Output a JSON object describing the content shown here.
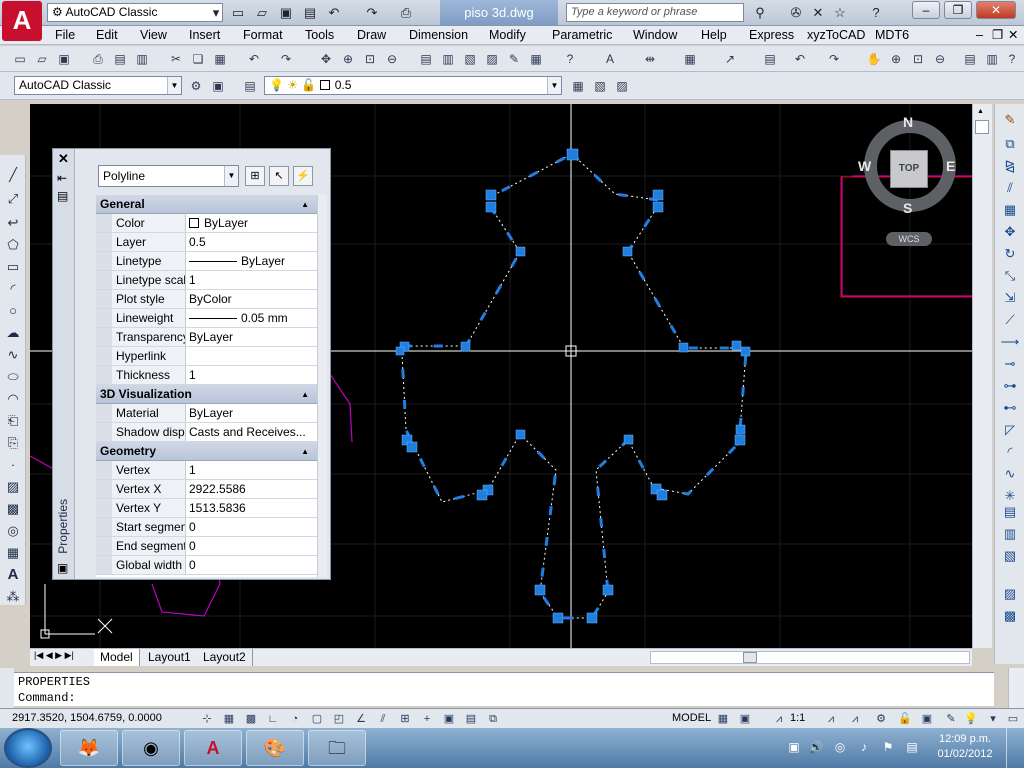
{
  "app": {
    "logo_letter": "A",
    "workspace": "AutoCAD Classic",
    "document_title": "piso 3d.dwg",
    "search_placeholder": "Type a keyword or phrase"
  },
  "menu": [
    "File",
    "Edit",
    "View",
    "Insert",
    "Format",
    "Tools",
    "Draw",
    "Dimension",
    "Modify",
    "Parametric",
    "Window",
    "Help",
    "Express",
    "xyzToCAD",
    "MDT6"
  ],
  "toolbar2": {
    "workspace": "AutoCAD Classic",
    "layer": "0.5"
  },
  "properties": {
    "object_type": "Polyline",
    "vertical_label": "Properties",
    "general": {
      "title": "General",
      "rows": [
        {
          "key": "Color",
          "value": "ByLayer"
        },
        {
          "key": "Layer",
          "value": "0.5"
        },
        {
          "key": "Linetype",
          "value": "ByLayer"
        },
        {
          "key": "Linetype scale",
          "value": "1"
        },
        {
          "key": "Plot style",
          "value": "ByColor"
        },
        {
          "key": "Lineweight",
          "value": "0.05 mm"
        },
        {
          "key": "Transparency",
          "value": "ByLayer"
        },
        {
          "key": "Hyperlink",
          "value": ""
        },
        {
          "key": "Thickness",
          "value": "1"
        }
      ]
    },
    "viz": {
      "title": "3D Visualization",
      "rows": [
        {
          "key": "Material",
          "value": "ByLayer"
        },
        {
          "key": "Shadow display",
          "value": "Casts and Receives..."
        }
      ]
    },
    "geometry": {
      "title": "Geometry",
      "rows": [
        {
          "key": "Vertex",
          "value": "1"
        },
        {
          "key": "Vertex X",
          "value": "2922.5586"
        },
        {
          "key": "Vertex Y",
          "value": "1513.5836"
        },
        {
          "key": "Start segment ...",
          "value": "0"
        },
        {
          "key": "End segment ...",
          "value": "0"
        },
        {
          "key": "Global width",
          "value": "0"
        }
      ]
    }
  },
  "viewcube": {
    "n": "N",
    "s": "S",
    "e": "E",
    "w": "W",
    "top": "TOP",
    "wcs": "WCS"
  },
  "tabs": [
    "Model",
    "Layout1",
    "Layout2"
  ],
  "command": {
    "line1": "PROPERTIES",
    "line2": "Command:"
  },
  "status": {
    "coords": "2917.3520, 1504.6759, 0.0000",
    "model": "MODEL",
    "scale": "1:1"
  },
  "clock": {
    "time": "12:09 p.m.",
    "date": "01/02/2012"
  }
}
